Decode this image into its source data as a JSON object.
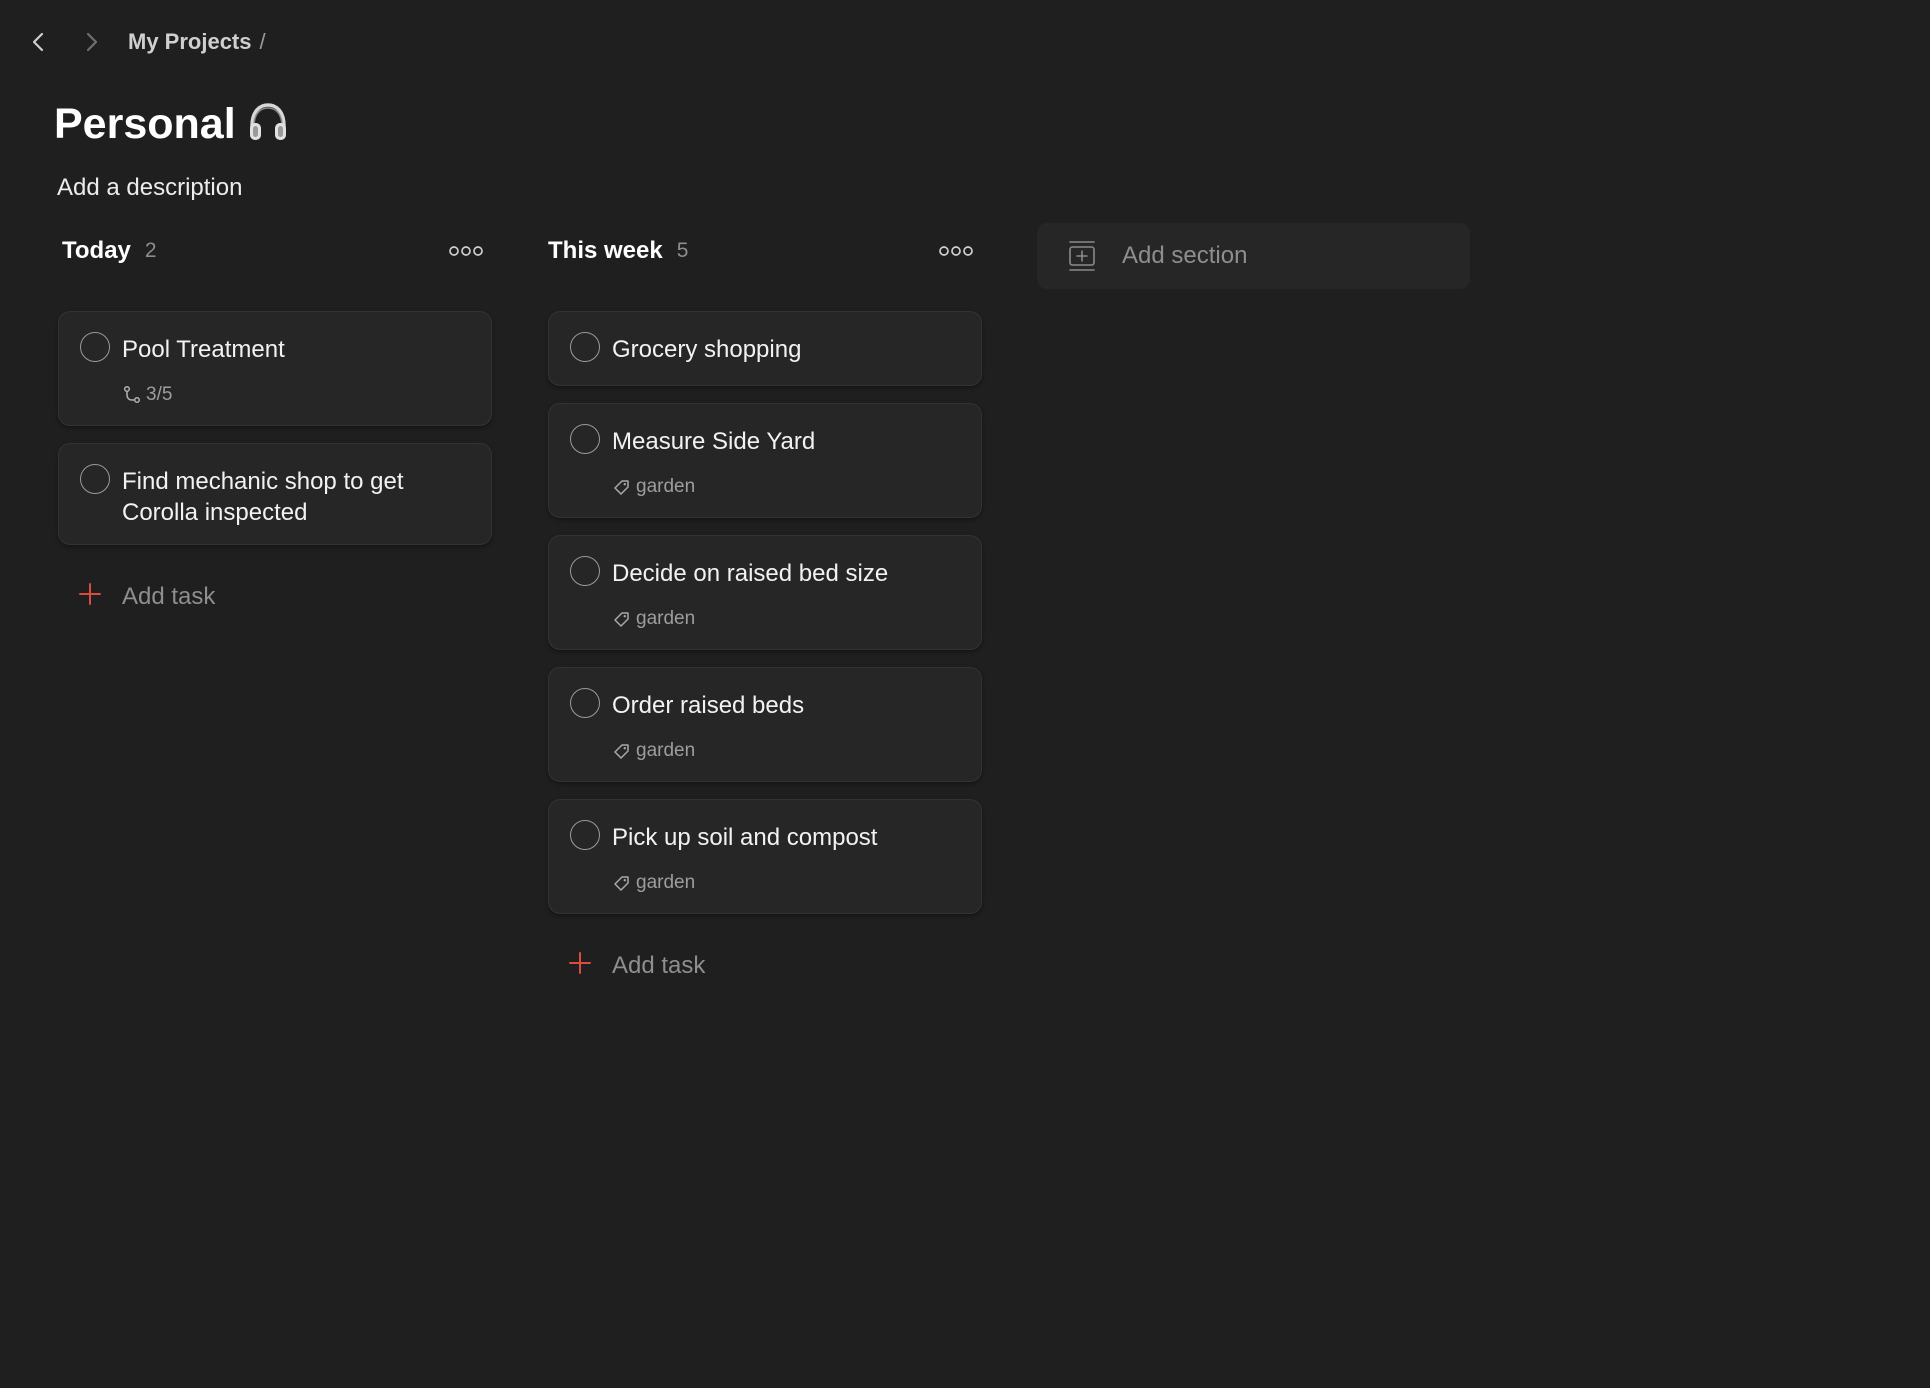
{
  "nav": {
    "back_icon": "chevron-left-icon",
    "forward_icon": "chevron-right-icon",
    "breadcrumb": [
      "My Projects"
    ],
    "breadcrumb_separator": "/"
  },
  "project": {
    "title": "Personal",
    "title_icon": "headphones-icon",
    "description": "Add a description"
  },
  "sections": [
    {
      "title": "Today",
      "count": "2",
      "tasks": [
        {
          "title": "Pool Treatment",
          "subtasks": "3/5"
        },
        {
          "title": "Find mechanic shop to get Corolla inspected"
        }
      ],
      "add_task_label": "Add task"
    },
    {
      "title": "This week",
      "count": "5",
      "tasks": [
        {
          "title": "Grocery shopping"
        },
        {
          "title": "Measure Side Yard",
          "label": "garden"
        },
        {
          "title": "Decide on raised bed size",
          "label": "garden"
        },
        {
          "title": "Order raised beds",
          "label": "garden"
        },
        {
          "title": "Pick up soil and compost",
          "label": "garden"
        }
      ],
      "add_task_label": "Add task"
    }
  ],
  "add_section": {
    "label": "Add section"
  },
  "colors": {
    "background": "#1f1f1f",
    "card": "#262626",
    "accent": "#dc4c3e",
    "muted_text": "#8e8e8e"
  }
}
